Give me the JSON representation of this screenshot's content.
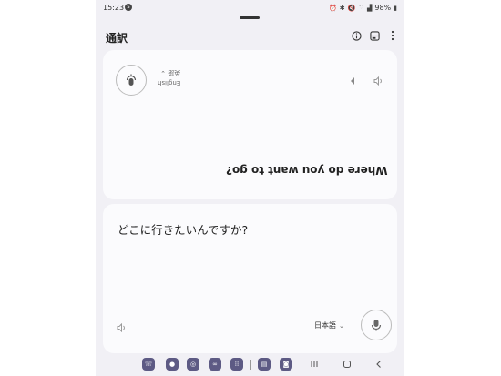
{
  "status_bar": {
    "time": "15:23",
    "notification_badge": "S",
    "battery": "98%"
  },
  "app_bar": {
    "title": "通訳"
  },
  "top_panel": {
    "language_native": "英語",
    "language_english": "English",
    "translated_text": "Where do you want to go?"
  },
  "bottom_panel": {
    "source_text": "どこに行きたいんですか?",
    "language": "日本語"
  },
  "colors": {
    "background": "#f1f0f5",
    "card": "#fbfbfd",
    "app_icon": "#5d5a84"
  },
  "taskbar": {
    "apps": [
      "phone-icon",
      "messages-icon",
      "chrome-icon",
      "galaxy-store-icon",
      "apps-grid-icon",
      "notes-icon",
      "instagram-icon"
    ]
  }
}
